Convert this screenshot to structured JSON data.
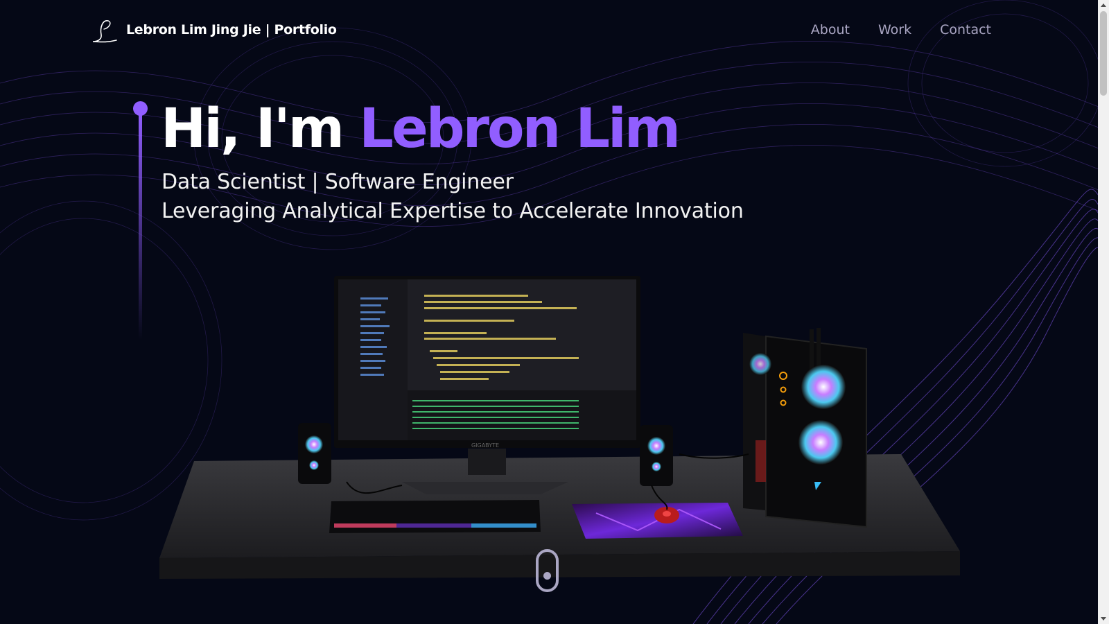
{
  "navbar": {
    "logo_icon": "signature-l-logo",
    "brand": "Lebron Lim Jing Jie  | Portfolio",
    "links": [
      {
        "label": "About"
      },
      {
        "label": "Work"
      },
      {
        "label": "Contact"
      }
    ]
  },
  "hero": {
    "greeting": "Hi, I'm ",
    "name": "Lebron Lim",
    "subtitle_line1": "Data Scientist | Software Engineer",
    "subtitle_line2": "Leveraging Analytical Expertise to Accelerate Innovation"
  },
  "scene": {
    "description_icon": "desktop-computer-3d-model",
    "monitor_brand": "GIGABYTE"
  },
  "scroll": {
    "icon": "mouse-scroll-icon"
  },
  "colors": {
    "background": "#050816",
    "accent": "#915eff",
    "nav_text": "#aaa6c3",
    "text": "#ffffff"
  }
}
